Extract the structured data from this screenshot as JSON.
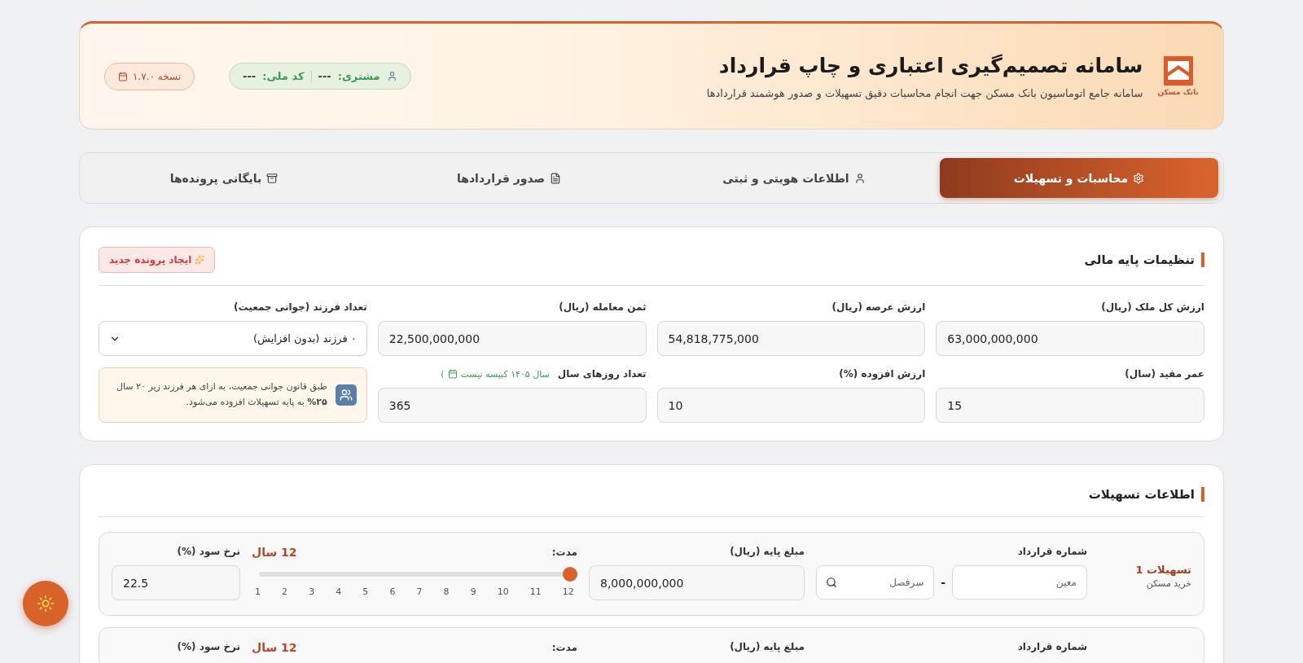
{
  "header": {
    "logo_text": "بانک مسکن",
    "title": "سامانه تصمیم‌گیری اعتباری و چاپ قرارداد",
    "subtitle": "سامانه جامع اتوماسیون بانک مسکن جهت انجام محاسبات دقیق تسهیلات و صدور هوشمند قراردادها",
    "customer_label": "مشتری:",
    "customer_value": "---",
    "national_id_label": "کد ملی:",
    "national_id_value": "---",
    "version": "نسخه ۱.۷.۰"
  },
  "tabs": [
    {
      "label": "محاسبات و تسهیلات",
      "selected": true
    },
    {
      "label": "اطلاعات هویتی و ثبتی",
      "selected": false
    },
    {
      "label": "صدور قراردادها",
      "selected": false
    },
    {
      "label": "بایگانی پرونده‌ها",
      "selected": false
    }
  ],
  "financial_settings": {
    "title": "تنظیمات پایه مالی",
    "new_file_button": "ایجاد پرونده جدید",
    "fields": [
      {
        "kind": "input",
        "label": "ارزش کل ملک (ریال)",
        "value": "63,000,000,000"
      },
      {
        "kind": "input",
        "label": "ارزش عرصه (ریال)",
        "value": "54,818,775,000"
      },
      {
        "kind": "input",
        "label": "ثمن معامله (ریال)",
        "value": "22,500,000,000"
      },
      {
        "kind": "select",
        "label": "تعداد فرزند (جوانی جمعیت)",
        "value": "۰ فرزند (بدون افزایش)"
      },
      {
        "kind": "input",
        "label": "عمر مفید (سال)",
        "value": "15"
      },
      {
        "kind": "input",
        "label": "ارزش افزوده (%)",
        "value": "10"
      },
      {
        "kind": "input",
        "label": "تعداد روزهای سال",
        "value": "365",
        "note_open": "(",
        "note": "سال ۱۴۰۵ کبیسه نیست"
      },
      {
        "kind": "info",
        "text": "طبق قانون جوانی جمعیت، به ازای هر فرزند زیر ۲۰ سال **۲۵%** به پایه تسهیلات افزوده می‌شود."
      }
    ]
  },
  "loans": {
    "title": "اطلاعات تسهیلات",
    "items": [
      {
        "name": "تسهیلات 1",
        "type": "خرید مسکن",
        "contract_label": "شماره قرارداد",
        "contract_part1_placeholder": "معین",
        "separator": "-",
        "contract_part2_placeholder": "سرفصل",
        "amount_label": "مبلغ پایه (ریال)",
        "amount": "8,000,000,000",
        "duration_label": "مدت:",
        "duration_value": "12 سال",
        "level": 1,
        "ticks": [
          "12",
          "11",
          "10",
          "9",
          "8",
          "7",
          "6",
          "5",
          "4",
          "3",
          "2",
          "1"
        ],
        "rate_label": "نرخ سود (%)",
        "rate": "22.5"
      },
      {
        "contract_label": "شماره قرارداد",
        "amount_label": "مبلغ پایه (ریال)",
        "duration_label": "مدت:",
        "duration_value": "12 سال",
        "rate_label": "نرخ سود (%)"
      }
    ]
  }
}
